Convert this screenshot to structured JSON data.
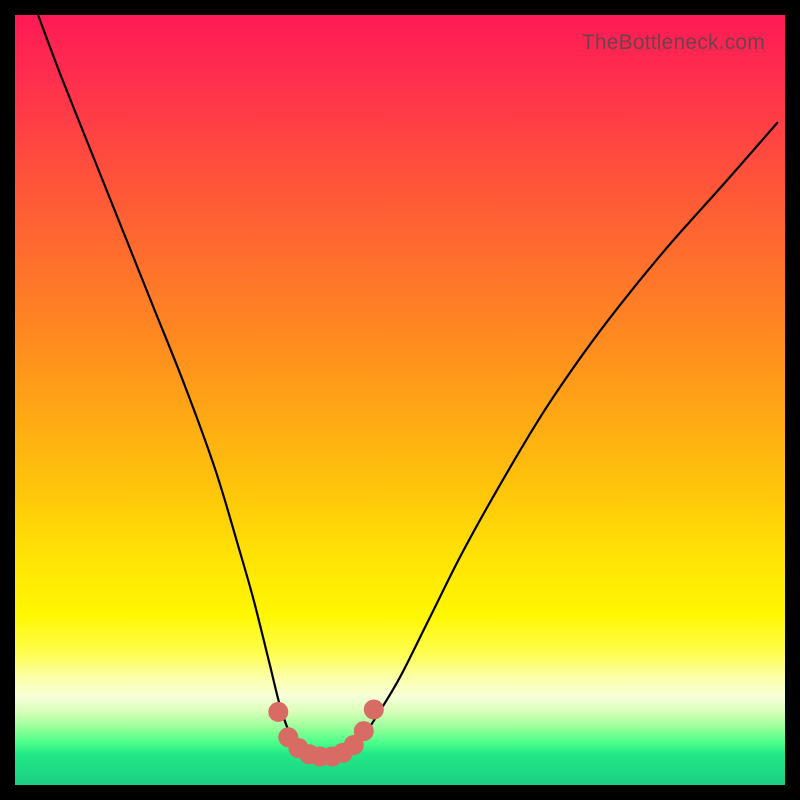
{
  "watermark": "TheBottleneck.com",
  "chart_data": {
    "type": "line",
    "title": "",
    "xlabel": "",
    "ylabel": "",
    "xlim": [
      0,
      100
    ],
    "ylim": [
      0,
      100
    ],
    "series": [
      {
        "name": "bottleneck-curve",
        "x": [
          3,
          6,
          10,
          14,
          18,
          22,
          26,
          29,
          31,
          33,
          34.5,
          36,
          37.5,
          39,
          41,
          43,
          45,
          47,
          50,
          54,
          58,
          63,
          69,
          76,
          84,
          92,
          99
        ],
        "y": [
          100,
          92,
          82,
          72,
          62,
          52,
          41,
          31,
          24,
          16,
          10,
          6,
          4,
          3.5,
          3.5,
          4,
          6,
          9,
          14,
          22,
          30,
          39,
          49,
          59,
          69,
          78,
          86
        ],
        "color": "#000000"
      }
    ],
    "markers": [
      {
        "name": "bottom-cluster",
        "x": [
          34.2,
          35.5,
          36.8,
          38.2,
          39.6,
          41.2,
          42.6,
          44.0,
          45.3,
          46.6
        ],
        "y": [
          9.5,
          6.2,
          4.8,
          4.0,
          3.7,
          3.7,
          4.2,
          5.2,
          7.0,
          9.8
        ],
        "color": "#d86b63",
        "size": 10
      }
    ],
    "gradient_stops": [
      {
        "pos": 0.0,
        "color": "#ff1a55"
      },
      {
        "pos": 0.5,
        "color": "#ffb010"
      },
      {
        "pos": 0.8,
        "color": "#ffff30"
      },
      {
        "pos": 0.92,
        "color": "#80ff90"
      },
      {
        "pos": 1.0,
        "color": "#1ccf82"
      }
    ]
  }
}
